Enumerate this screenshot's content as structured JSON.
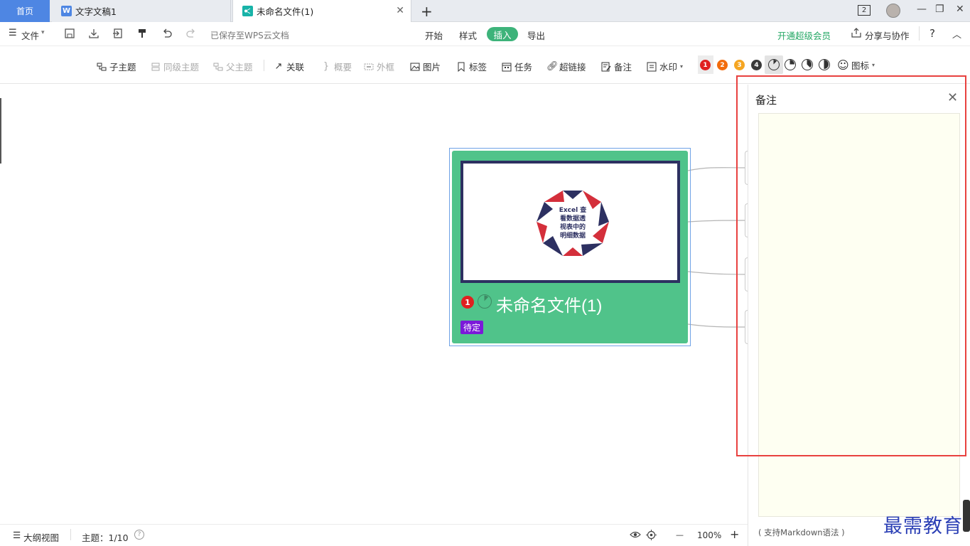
{
  "tabs": {
    "home": "首页",
    "doc": "文字文稿1",
    "active": "未命名文件(1)",
    "add": "+",
    "close": "✕"
  },
  "window": {
    "badge": "2",
    "min": "—",
    "restore": "❐",
    "close": "✕"
  },
  "menu": {
    "file": "文件",
    "saved": "已保存至WPS云文档",
    "start": "开始",
    "style": "样式",
    "insert": "插入",
    "export": "导出",
    "vip": "开通超级会员",
    "share": "分享与协作",
    "help": "?",
    "collapse": "︿"
  },
  "toolbar": {
    "subtopic": "子主题",
    "sibling": "同级主题",
    "parent": "父主题",
    "relation": "关联",
    "summary": "概要",
    "boundary": "外框",
    "image": "图片",
    "tag": "标签",
    "task": "任务",
    "link": "超链接",
    "note": "备注",
    "watermark": "水印",
    "priorities": [
      "1",
      "2",
      "3",
      "4"
    ],
    "progress_levels": [
      0.125,
      0.25,
      0.375,
      0.5
    ],
    "icons": "图标",
    "colors": {
      "p1": "#e02020",
      "p2": "#f26c0d",
      "p3": "#f5a623",
      "p4": "#3a3a3a"
    }
  },
  "canvas": {
    "root_title": "未命名文件(1)",
    "root_priority": "1",
    "root_tag": "待定",
    "image_text": [
      "Excel 查",
      "看数据透",
      "视表中的",
      "明细数据"
    ],
    "node_color": "#50c38a"
  },
  "notes": {
    "title": "备注",
    "close": "✕",
    "placeholder": "",
    "hint": "( 支持Markdown语法 )"
  },
  "status": {
    "outline": "大纲视图",
    "topic": "主题：1/10",
    "zoom": "100%",
    "minus": "—",
    "plus": "+"
  },
  "watermark_text": "最需教育"
}
